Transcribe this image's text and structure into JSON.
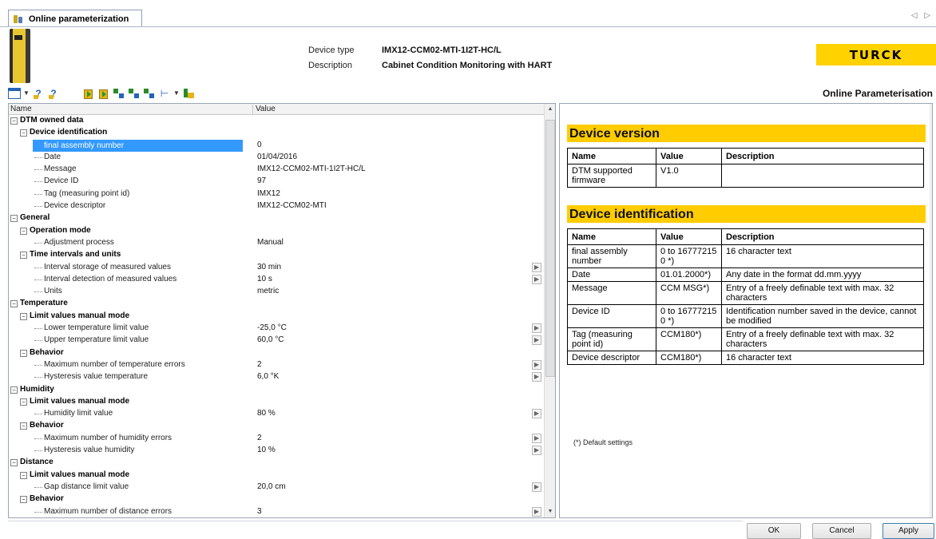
{
  "tab": {
    "title": "Online parameterization",
    "nav": "◁ ▷"
  },
  "header": {
    "device_type_label": "Device type",
    "device_type_value": "IMX12-CCM02-MTI-1I2T-HC/L",
    "description_label": "Description",
    "description_value": "Cabinet Condition Monitoring with HART",
    "logo_text": "TURCK",
    "panel_title": "Online Parameterisation"
  },
  "grid": {
    "col_name": "Name",
    "col_value": "Value",
    "rows": [
      {
        "level": 0,
        "name": "DTM owned data",
        "value": "",
        "toggle": "−"
      },
      {
        "level": 1,
        "name": "Device identification",
        "value": "",
        "toggle": "−"
      },
      {
        "level": 2,
        "name": "final assembly number",
        "value": "0",
        "selected": true
      },
      {
        "level": 2,
        "name": "Date",
        "value": "01/04/2016"
      },
      {
        "level": 2,
        "name": "Message",
        "value": "IMX12-CCM02-MTI-1I2T-HC/L"
      },
      {
        "level": 2,
        "name": "Device ID",
        "value": "97"
      },
      {
        "level": 2,
        "name": "Tag (measuring point id)",
        "value": "IMX12"
      },
      {
        "level": 2,
        "name": "Device descriptor",
        "value": "IMX12-CCM02-MTI"
      },
      {
        "level": 0,
        "name": "General",
        "value": "",
        "toggle": "−"
      },
      {
        "level": 1,
        "name": "Operation mode",
        "value": "",
        "toggle": "−"
      },
      {
        "level": 2,
        "name": "Adjustment process",
        "value": "Manual"
      },
      {
        "level": 1,
        "name": "Time intervals and units",
        "value": "",
        "toggle": "−"
      },
      {
        "level": 2,
        "name": "Interval storage of measured values",
        "value": "30 min",
        "btn": true
      },
      {
        "level": 2,
        "name": "Interval detection of measured values",
        "value": "10 s",
        "btn": true
      },
      {
        "level": 2,
        "name": "Units",
        "value": "metric"
      },
      {
        "level": 0,
        "name": "Temperature",
        "value": "",
        "toggle": "−"
      },
      {
        "level": 1,
        "name": "Limit values manual mode",
        "value": "",
        "toggle": "−"
      },
      {
        "level": 2,
        "name": "Lower temperature limit value",
        "value": "-25,0 °C",
        "btn": true
      },
      {
        "level": 2,
        "name": "Upper temperature limit value",
        "value": "60,0 °C",
        "btn": true
      },
      {
        "level": 1,
        "name": "Behavior",
        "value": "",
        "toggle": "−"
      },
      {
        "level": 2,
        "name": "Maximum number of temperature errors",
        "value": "2",
        "btn": true
      },
      {
        "level": 2,
        "name": "Hysteresis value temperature",
        "value": "6,0 °K",
        "btn": true
      },
      {
        "level": 0,
        "name": "Humidity",
        "value": "",
        "toggle": "−"
      },
      {
        "level": 1,
        "name": "Limit values manual mode",
        "value": "",
        "toggle": "−"
      },
      {
        "level": 2,
        "name": "Humidity limit value",
        "value": "80 %",
        "btn": true
      },
      {
        "level": 1,
        "name": "Behavior",
        "value": "",
        "toggle": "−"
      },
      {
        "level": 2,
        "name": "Maximum number of humidity errors",
        "value": "2",
        "btn": true
      },
      {
        "level": 2,
        "name": "Hysteresis value humidity",
        "value": "10 %",
        "btn": true
      },
      {
        "level": 0,
        "name": "Distance",
        "value": "",
        "toggle": "−"
      },
      {
        "level": 1,
        "name": "Limit values manual mode",
        "value": "",
        "toggle": "−"
      },
      {
        "level": 2,
        "name": "Gap distance limit value",
        "value": "20,0 cm",
        "btn": true
      },
      {
        "level": 1,
        "name": "Behavior",
        "value": "",
        "toggle": "−"
      },
      {
        "level": 2,
        "name": "Maximum number of distance errors",
        "value": "3",
        "btn": true
      }
    ]
  },
  "doc": {
    "section1_title": "Device version",
    "section2_title": "Device identification",
    "col_name": "Name",
    "col_value": "Value",
    "col_description": "Description",
    "version_rows": [
      {
        "name": "DTM supported firmware",
        "value": "V1.0",
        "description": ""
      }
    ],
    "ident_rows": [
      {
        "name": "final assembly number",
        "value": "0 to 16777215 0 *)",
        "description": "16 character text"
      },
      {
        "name": "Date",
        "value": "01.01.2000*)",
        "description": "Any date in the format dd.mm.yyyy"
      },
      {
        "name": "Message",
        "value": "CCM MSG*)",
        "description": "Entry of a freely definable text with max. 32 characters"
      },
      {
        "name": "Device ID",
        "value": "0 to 16777215 0 *)",
        "description": "Identification number saved in the device, cannot be modified"
      },
      {
        "name": "Tag (measuring point id)",
        "value": "CCM180*)",
        "description": "Entry of a freely definable text with max. 32 characters"
      },
      {
        "name": "Device descriptor",
        "value": "CCM180*)",
        "description": "16 character text"
      }
    ],
    "footnote": "(*) Default settings"
  },
  "buttons": {
    "ok": "OK",
    "cancel": "Cancel",
    "apply": "Apply"
  }
}
